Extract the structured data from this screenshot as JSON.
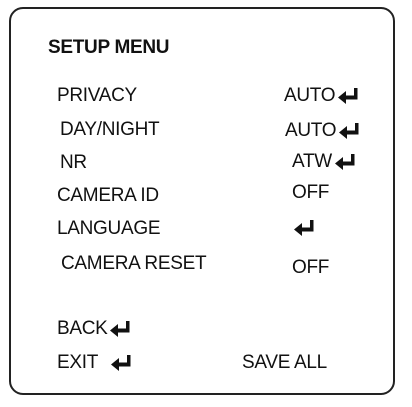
{
  "menu": {
    "title": "SETUP MENU",
    "items": [
      {
        "label": "PRIVACY",
        "value": "AUTO",
        "enter": true
      },
      {
        "label": "DAY/NIGHT",
        "value": "AUTO",
        "enter": true
      },
      {
        "label": "NR",
        "value": "ATW",
        "enter": true
      },
      {
        "label": "CAMERA ID",
        "value": "OFF",
        "enter": false
      },
      {
        "label": "LANGUAGE",
        "value": "",
        "enter": true
      },
      {
        "label": "CAMERA RESET",
        "value": "OFF",
        "enter": false
      }
    ],
    "back_label": "BACK",
    "exit_label": "EXIT",
    "save_all_label": "SAVE ALL"
  },
  "icons": {
    "enter": "enter-return-arrow-icon"
  },
  "colors": {
    "background": "#ffffff",
    "text": "#111111",
    "frame": "#222222"
  }
}
